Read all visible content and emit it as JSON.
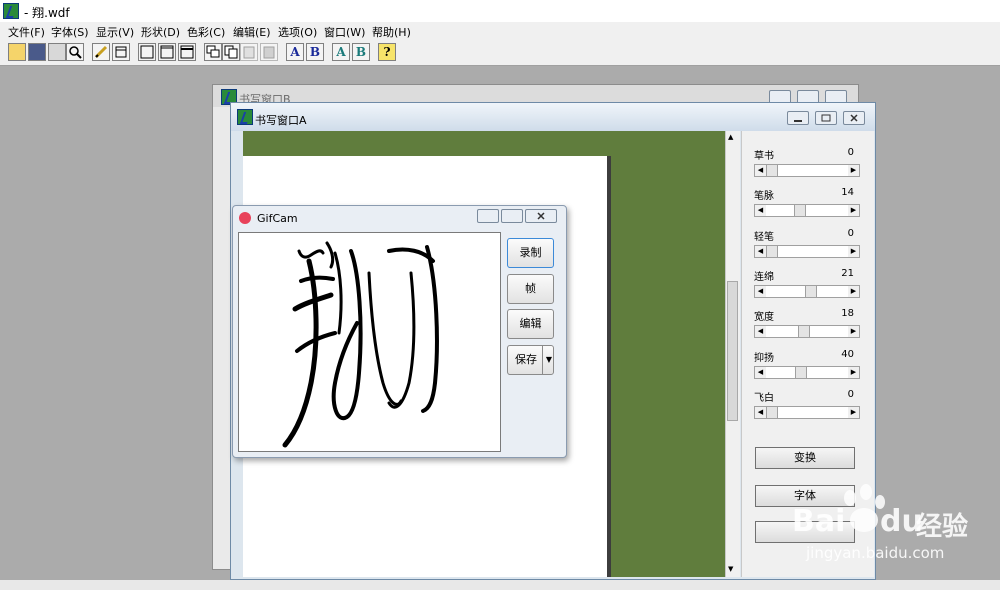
{
  "app": {
    "title": "- 翔.wdf"
  },
  "menu": [
    "文件(F)",
    "字体(S)",
    "显示(V)",
    "形状(D)",
    "色彩(C)",
    "编辑(E)",
    "选项(O)",
    "窗口(W)",
    "帮助(H)"
  ],
  "toolbar": {
    "letters": [
      "A",
      "B",
      "A",
      "B"
    ],
    "help": "?"
  },
  "windowB": {
    "title": "书写窗口B"
  },
  "windowA": {
    "title": "书写窗口A"
  },
  "sliders": [
    {
      "label": "草书",
      "value": "0",
      "level": 0.0
    },
    {
      "label": "笔脉",
      "value": "14",
      "level": 0.4
    },
    {
      "label": "轻笔",
      "value": "0",
      "level": 0.0
    },
    {
      "label": "连绵",
      "value": "21",
      "level": 0.55
    },
    {
      "label": "宽度",
      "value": "18",
      "level": 0.45
    },
    {
      "label": "抑扬",
      "value": "40",
      "level": 0.42
    },
    {
      "label": "飞白",
      "value": "0",
      "level": 0.0
    }
  ],
  "panel_buttons": {
    "transform": "变换",
    "font": "字体",
    "third": ""
  },
  "gifcam": {
    "title": "GifCam",
    "record": "录制",
    "frame": "帧",
    "edit": "编辑",
    "save": "保存"
  },
  "watermark": {
    "brand": "Bai",
    "du": "du",
    "jingyan": "经验",
    "url": "jingyan.baidu.com"
  }
}
